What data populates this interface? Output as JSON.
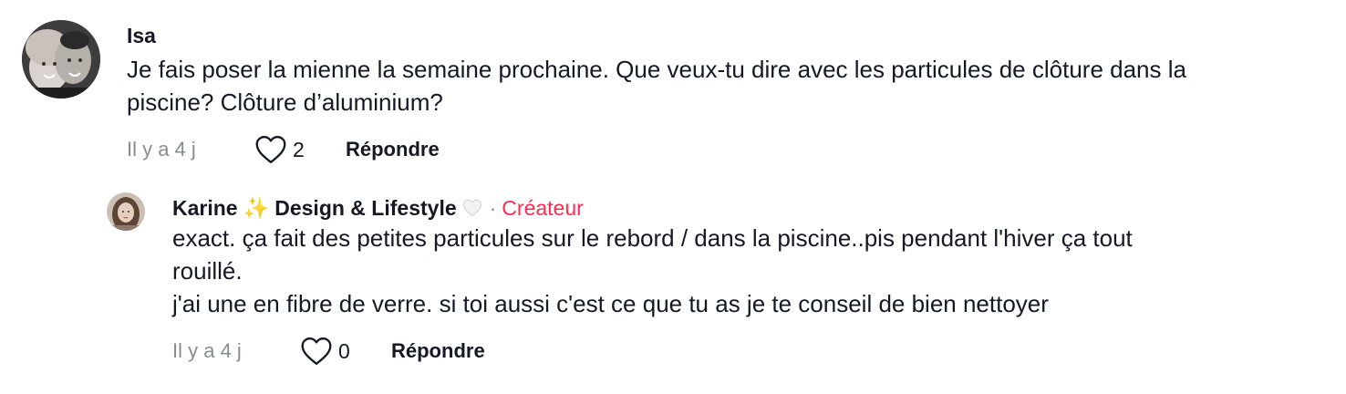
{
  "comments": [
    {
      "username": "Isa",
      "text": "Je fais poser la mienne la semaine prochaine. Que veux-tu dire avec les particules de clôture dans la\npiscine? Clôture d’aluminium?",
      "timestamp": "Il y a 4 j",
      "likes": "2",
      "reply_label": "Répondre"
    }
  ],
  "reply": {
    "username": "Karine",
    "username_suffix": "Design & Lifestyle",
    "sparkle": "✨",
    "separator": "·",
    "creator_label": "Créateur",
    "text": "exact. ça fait des petites particules sur le rebord / dans la piscine..pis pendant l'hiver ça tout\nrouillé.\nj'ai une en fibre de verre. si toi aussi c'est ce que tu as je te conseil de bien nettoyer",
    "timestamp": "Il y a 4 j",
    "likes": "0",
    "reply_label": "Répondre"
  },
  "colors": {
    "text": "#161823",
    "muted": "#8a8b91",
    "creator": "#fe2c55"
  },
  "icons": [
    "heart-outline-icon",
    "white-heart-emoji-icon",
    "sparkles-emoji-icon"
  ]
}
